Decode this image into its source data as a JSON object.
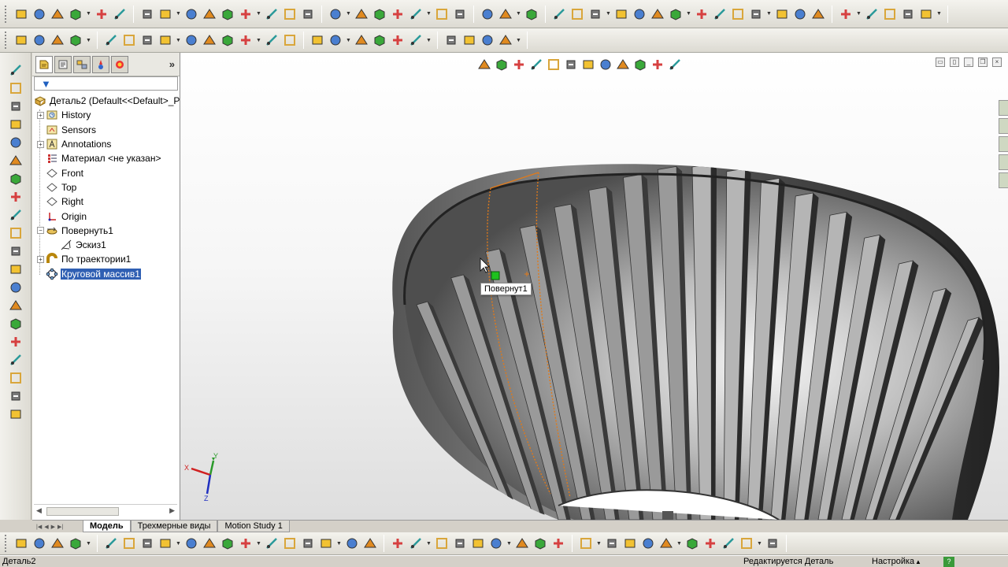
{
  "feature_tree": {
    "root_label": "Деталь2  (Default<<Default>_Ph",
    "filter_icon": "funnel-icon",
    "items": [
      {
        "label": "History",
        "icon": "history-folder-icon"
      },
      {
        "label": "Sensors",
        "icon": "sensors-icon"
      },
      {
        "label": "Annotations",
        "icon": "annotations-icon"
      },
      {
        "label": "Материал <не указан>",
        "icon": "material-icon"
      },
      {
        "label": "Front",
        "icon": "plane-icon"
      },
      {
        "label": "Top",
        "icon": "plane-icon"
      },
      {
        "label": "Right",
        "icon": "plane-icon"
      },
      {
        "label": "Origin",
        "icon": "origin-icon"
      },
      {
        "label": "Повернуть1",
        "icon": "revolve-icon"
      },
      {
        "label": "Эскиз1",
        "icon": "sketch-icon"
      },
      {
        "label": "По траектории1",
        "icon": "sweep-icon"
      },
      {
        "label": "Круговой массив1",
        "icon": "circular-pattern-icon"
      }
    ]
  },
  "viewport": {
    "tooltip": "Повернут1",
    "triad": {
      "x": "X",
      "y": "Y",
      "z": "Z"
    }
  },
  "bottom_tabs": {
    "model": "Модель",
    "views_3d": "Трехмерные виды",
    "motion": "Motion Study 1"
  },
  "status": {
    "document": "Деталь2",
    "mode": "Редактируется Деталь",
    "settings": "Настройка"
  }
}
